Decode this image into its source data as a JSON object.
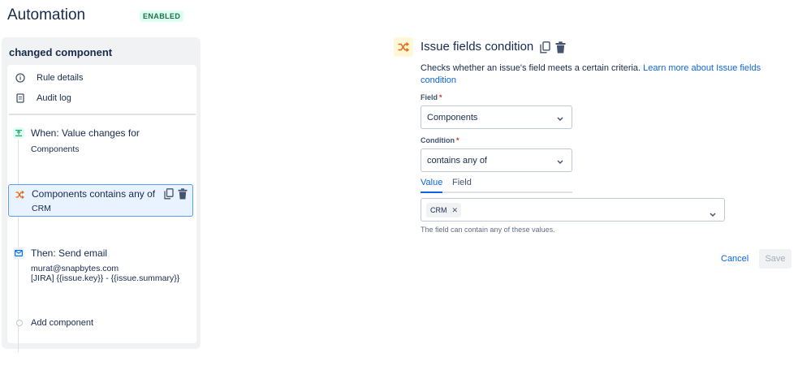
{
  "header": {
    "title": "Automation",
    "status_badge": "ENABLED"
  },
  "sidebar": {
    "title": "changed component",
    "menu": [
      {
        "label": "Rule details",
        "icon": "info-icon"
      },
      {
        "label": "Audit log",
        "icon": "audit-log-icon"
      }
    ],
    "steps": [
      {
        "title": "When: Value changes for",
        "subtitle": "Components",
        "icon": "trigger-icon",
        "color": "#22a06b"
      },
      {
        "title": "Components contains any of",
        "subtitle": "CRM",
        "icon": "shuffle-icon",
        "color": "#e56910"
      },
      {
        "title": "Then: Send email",
        "lines": [
          "murat@snapbytes.com",
          "[JIRA] {{issue.key}} - {{issue.summary}}"
        ],
        "icon": "mail-icon",
        "color": "#0c66e4"
      }
    ],
    "add_component": "Add component"
  },
  "panel": {
    "title": "Issue fields condition",
    "description": "Checks whether an issue's field meets a certain criteria.",
    "learn_more": "Learn more about Issue fields condition",
    "field_label": "Field",
    "field_value": "Components",
    "condition_label": "Condition",
    "condition_value": "contains any of",
    "tabs": [
      "Value",
      "Field"
    ],
    "values": [
      "CRM"
    ],
    "help_text": "The field can contain any of these values.",
    "cancel_label": "Cancel",
    "save_label": "Save"
  },
  "colors": {
    "accent": "#0c66e4",
    "selected_border": "#579dff",
    "condition_orange": "#e56910"
  }
}
